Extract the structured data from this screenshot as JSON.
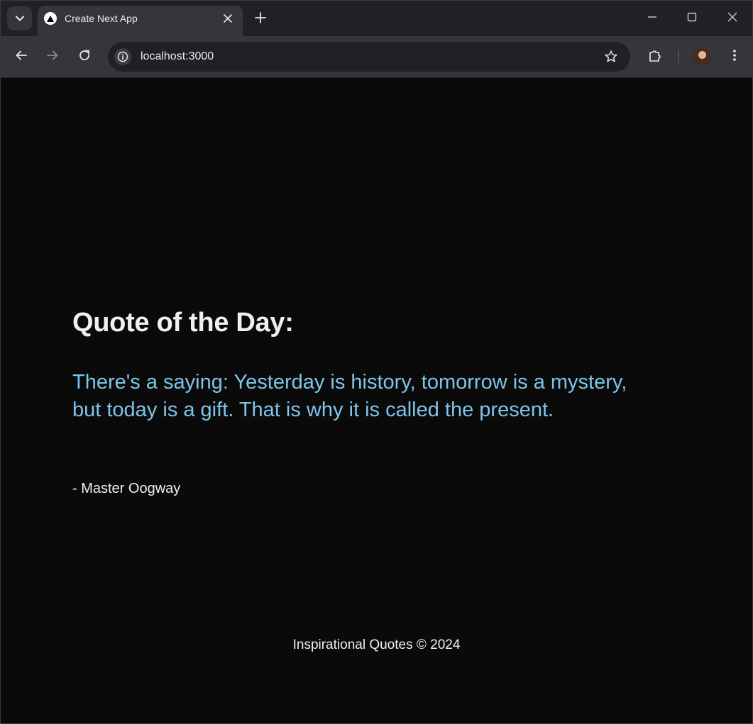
{
  "browser": {
    "tab": {
      "title": "Create Next App"
    },
    "omnibox": {
      "url": "localhost:3000"
    }
  },
  "page": {
    "heading": "Quote of the Day:",
    "quote": "There's a saying: Yesterday is history, tomorrow is a mystery, but today is a gift. That is why it is called the present.",
    "author": "- Master Oogway",
    "footer": "Inspirational Quotes © 2024"
  },
  "colors": {
    "background": "#0a0a0a",
    "quote_text": "#7ec4ea",
    "heading_text": "#f0f0f0",
    "tabstrip": "#202124",
    "toolbar": "#35363a"
  },
  "icons": {
    "tab_search": "chevron-down-icon",
    "favicon": "nextjs-triangle-icon",
    "tab_close": "close-icon",
    "new_tab": "plus-icon",
    "minimize": "minimize-icon",
    "maximize": "maximize-icon",
    "close_window": "close-icon",
    "back": "arrow-left-icon",
    "forward": "arrow-right-icon",
    "reload": "reload-icon",
    "site_info": "info-icon",
    "bookmark": "star-icon",
    "extensions": "puzzle-icon",
    "menu": "kebab-menu-icon"
  }
}
